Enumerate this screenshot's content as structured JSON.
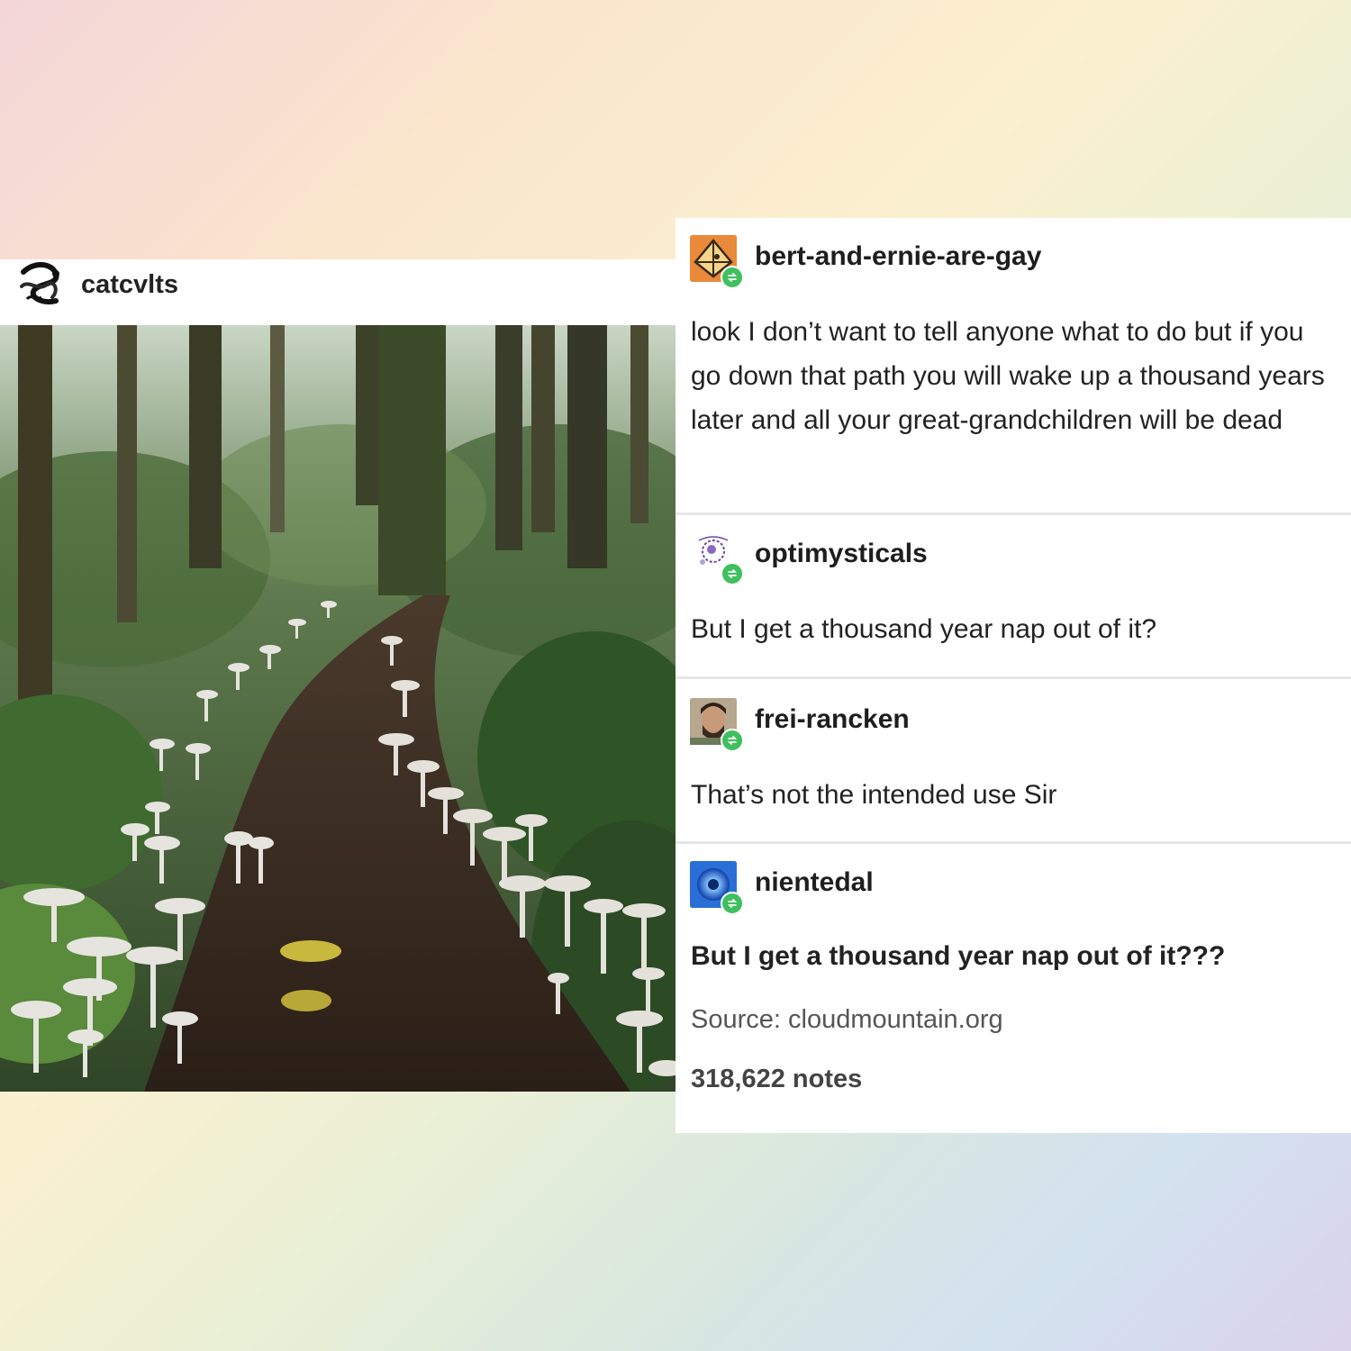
{
  "original_post": {
    "username": "catcvlts",
    "avatar": "snake-icon",
    "photo": "mushroom-lined-forest-path"
  },
  "thread": [
    {
      "username": "bert-and-ernie-are-gay",
      "avatar": "orange-triangle-avatar",
      "text": "look I don’t want to tell anyone what to do but if you go down that path you will wake up a thousand years later and all your great-grandchildren will be dead",
      "bold": false
    },
    {
      "username": "optimysticals",
      "avatar": "purple-sketch-avatar",
      "text": "But I get a thousand year nap out of it?",
      "bold": false
    },
    {
      "username": "frei-rancken",
      "avatar": "bearded-man-avatar",
      "text": "That’s not the intended use Sir",
      "bold": false
    },
    {
      "username": "nientedal",
      "avatar": "blue-orb-avatar",
      "text": "But I get a thousand year nap out of it???",
      "bold": true
    }
  ],
  "footer": {
    "source_label": "Source:",
    "source_url": "cloudmountain.org",
    "notes": "318,622 notes"
  },
  "colors": {
    "reblog_badge": "#3fbf5d",
    "divider": "#e6e6e6",
    "text": "#222222"
  }
}
